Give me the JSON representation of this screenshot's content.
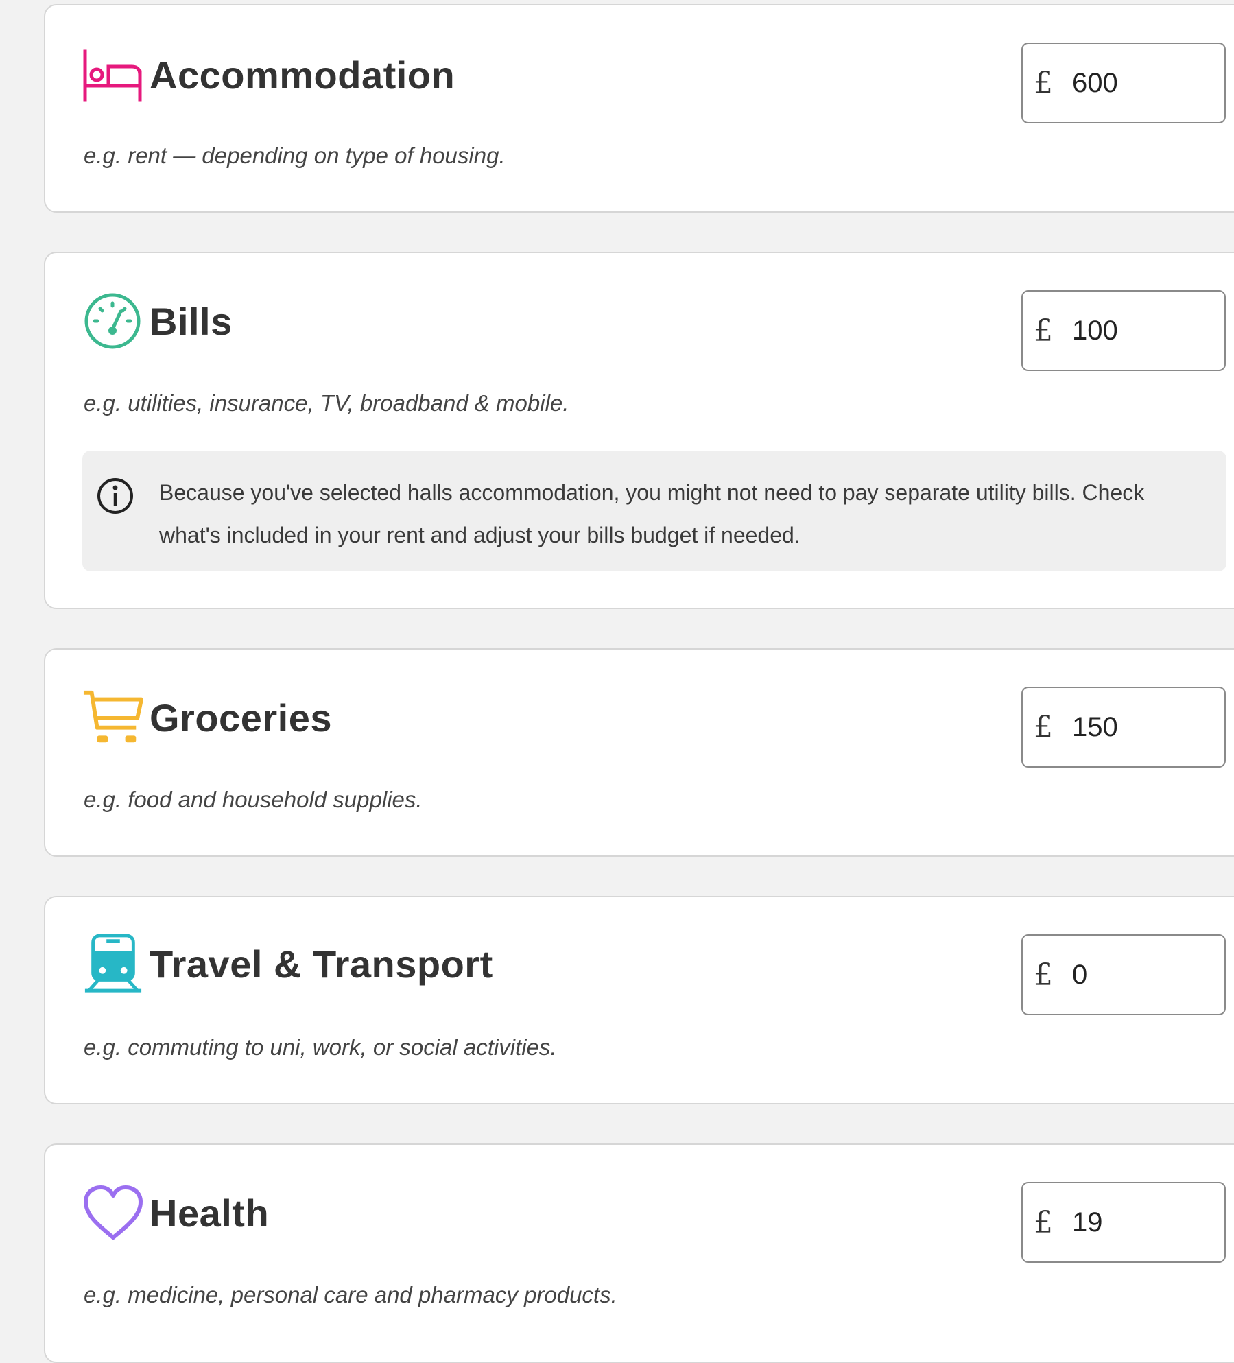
{
  "categories": [
    {
      "title": "Accommodation",
      "icon": "bed-icon",
      "description": "e.g. rent — depending on type of housing.",
      "currency": "£",
      "amount": "600",
      "color": "#e6197d"
    },
    {
      "title": "Bills",
      "icon": "gauge-icon",
      "description": "e.g. utilities, insurance, TV, broadband & mobile.",
      "currency": "£",
      "amount": "100",
      "color": "#3cb88f",
      "info": "Because you've selected halls accommodation, you might not need to pay separate utility bills. Check what's included in your rent and adjust your bills budget if needed."
    },
    {
      "title": "Groceries",
      "icon": "shopping-cart-icon",
      "description": "e.g. food and household supplies.",
      "currency": "£",
      "amount": "150",
      "color": "#f5b731"
    },
    {
      "title": "Travel & Transport",
      "icon": "train-icon",
      "description": "e.g. commuting to uni, work, or social activities.",
      "currency": "£",
      "amount": "0",
      "color": "#27b7c6"
    },
    {
      "title": "Health",
      "icon": "heart-icon",
      "description": "e.g. medicine, personal care and pharmacy products.",
      "currency": "£",
      "amount": "19",
      "color": "#9b6ff0"
    }
  ]
}
